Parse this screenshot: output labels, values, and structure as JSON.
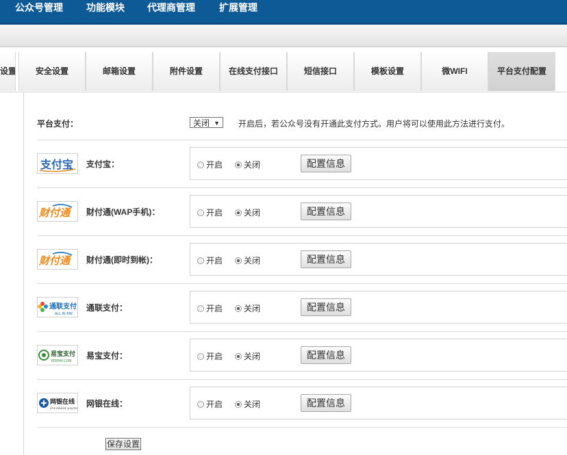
{
  "topnav": {
    "items": [
      "公众号管理",
      "功能模块",
      "代理商管理",
      "扩展管理"
    ]
  },
  "tabs": [
    "设置",
    "安全设置",
    "邮箱设置",
    "附件设置",
    "在线支付接口",
    "短信接口",
    "模板设置",
    "微WIFI",
    "平台支付配置"
  ],
  "active_tab": "平台支付配置",
  "platform": {
    "label": "平台支付：",
    "select_value": "关闭",
    "hint": "开启后，若公众号没有开通此支付方式。用户将可以使用此方法进行支付。"
  },
  "radio_labels": {
    "on": "开启",
    "off": "关闭"
  },
  "config_button": "配置信息",
  "save_button": "保存设置",
  "payments": [
    {
      "label": "支付宝：",
      "logo_text": "支付宝",
      "logo_icon": "alipay-logo-icon",
      "state": "关闭"
    },
    {
      "label": "财付通(WAP手机)：",
      "logo_text": "财付通",
      "logo_icon": "tenpay-logo-icon",
      "state": "关闭"
    },
    {
      "label": "财付通(即时到帐)：",
      "logo_text": "财付通",
      "logo_icon": "tenpay-logo-icon",
      "state": "关闭"
    },
    {
      "label": "通联支付：",
      "logo_text": "通联支付",
      "logo_sub": "ALL IN PAY",
      "logo_icon": "allinpay-logo-icon",
      "state": "关闭"
    },
    {
      "label": "易宝支付：",
      "logo_text": "易宝支付",
      "logo_sub": "YEEPAY.COM",
      "logo_icon": "yeepay-logo-icon",
      "state": "关闭"
    },
    {
      "label": "网银在线：",
      "logo_text": "网银在线",
      "logo_sub": "Chinabank payment",
      "logo_icon": "chinabank-logo-icon",
      "state": "关闭"
    }
  ],
  "colors": {
    "nav_bg": "#0d5a97",
    "alipay_blue": "#2c67b3",
    "tenpay_orange": "#f08a1c",
    "yeepay_green": "#3a8f3a"
  }
}
